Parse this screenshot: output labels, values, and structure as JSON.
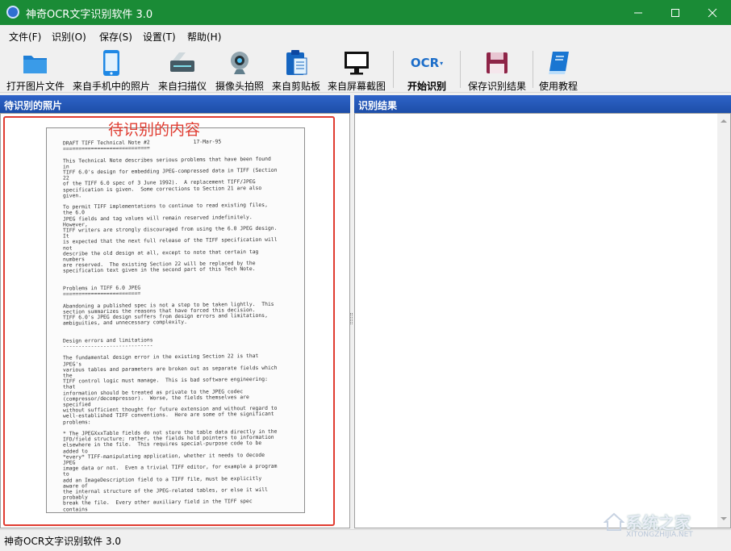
{
  "window": {
    "title": "神奇OCR文字识别软件 3.0",
    "controls": [
      "minimize",
      "maximize",
      "close"
    ]
  },
  "menu": [
    "文件(F)",
    "识别(O)",
    "保存(S)",
    "设置(T)",
    "帮助(H)"
  ],
  "toolbar": [
    {
      "label": "打开图片文件",
      "icon": "folder-icon"
    },
    {
      "label": "来自手机中的照片",
      "icon": "phone-icon"
    },
    {
      "label": "来自扫描仪",
      "icon": "scanner-icon"
    },
    {
      "label": "摄像头拍照",
      "icon": "webcam-icon"
    },
    {
      "label": "来自剪贴板",
      "icon": "clipboard-icon"
    },
    {
      "label": "来自屏幕截图",
      "icon": "monitor-icon"
    },
    {
      "label": "开始识别",
      "icon": "ocr-icon",
      "icon_text": "OCR"
    },
    {
      "label": "保存识别结果",
      "icon": "save-icon"
    },
    {
      "label": "使用教程",
      "icon": "book-icon"
    }
  ],
  "left_panel": {
    "title": "待识别的照片",
    "annotation": "待识别的内容"
  },
  "document_lines": [
    "DRAFT TIFF Technical Note #2              17-Mar-95",
    "============================",
    "",
    "This Technical Note describes serious problems that have been found",
    "in",
    "TIFF 6.0's design for embedding JPEG-compressed data in TIFF (Section",
    "22",
    "of the TIFF 6.0 spec of 3 June 1992).  A replacement TIFF/JPEG",
    "specification is given.  Some corrections to Section 21 are also",
    "given.",
    "",
    "To permit TIFF implementations to continue to read existing files,",
    "the 6.0",
    "JPEG fields and tag values will remain reserved indefinitely.",
    "However,",
    "TIFF writers are strongly discouraged from using the 6.0 JPEG design.",
    "It",
    "is expected that the next full release of the TIFF specification will",
    "not",
    "describe the old design at all, except to note that certain tag",
    "numbers",
    "are reserved.  The existing Section 22 will be replaced by the",
    "specification text given in the second part of this Tech Note.",
    "",
    "",
    "Problems in TIFF 6.0 JPEG",
    "=========================",
    "",
    "Abandoning a published spec is not a step to be taken lightly.  This",
    "section summarizes the reasons that have forced this decision.",
    "TIFF 6.0's JPEG design suffers from design errors and limitations,",
    "ambiguities, and unnecessary complexity.",
    "",
    "",
    "Design errors and limitations",
    "-----------------------------",
    "",
    "The fundamental design error in the existing Section 22 is that",
    "JPEG's",
    "various tables and parameters are broken out as separate fields which",
    "the",
    "TIFF control logic must manage.  This is bad software engineering:",
    "that",
    "information should be treated as private to the JPEG codec",
    "(compressor/decompressor).  Worse, the fields themselves are",
    "specified",
    "without sufficient thought for future extension and without regard to",
    "well-established TIFF conventions.  Here are some of the significant",
    "problems:",
    "",
    "* The JPEGXxxTable fields do not store the table data directly in the",
    "IFD/field structure; rather, the fields hold pointers to information",
    "elsewhere in the file.  This requires special-purpose code to be",
    "added to",
    "*every* TIFF-manipulating application, whether it needs to decode",
    "JPEG",
    "image data or not.  Even a trivial TIFF editor, for example a program",
    "to",
    "add an ImageDescription field to a TIFF file, must be explicitly",
    "aware of",
    "the internal structure of the JPEG-related tables, or else it will",
    "probably",
    "break the file.  Every other auxiliary field in the TIFF spec",
    "contains"
  ],
  "right_panel": {
    "title": "识别结果",
    "content": ""
  },
  "status": "神奇OCR文字识别软件 3.0",
  "watermark": {
    "brand": "系统之家",
    "url": "XITONGZHIJIA.NET"
  },
  "colors": {
    "titlebar": "#1a8b36",
    "panel_header": "#2159bd",
    "highlight": "#e03c31"
  }
}
